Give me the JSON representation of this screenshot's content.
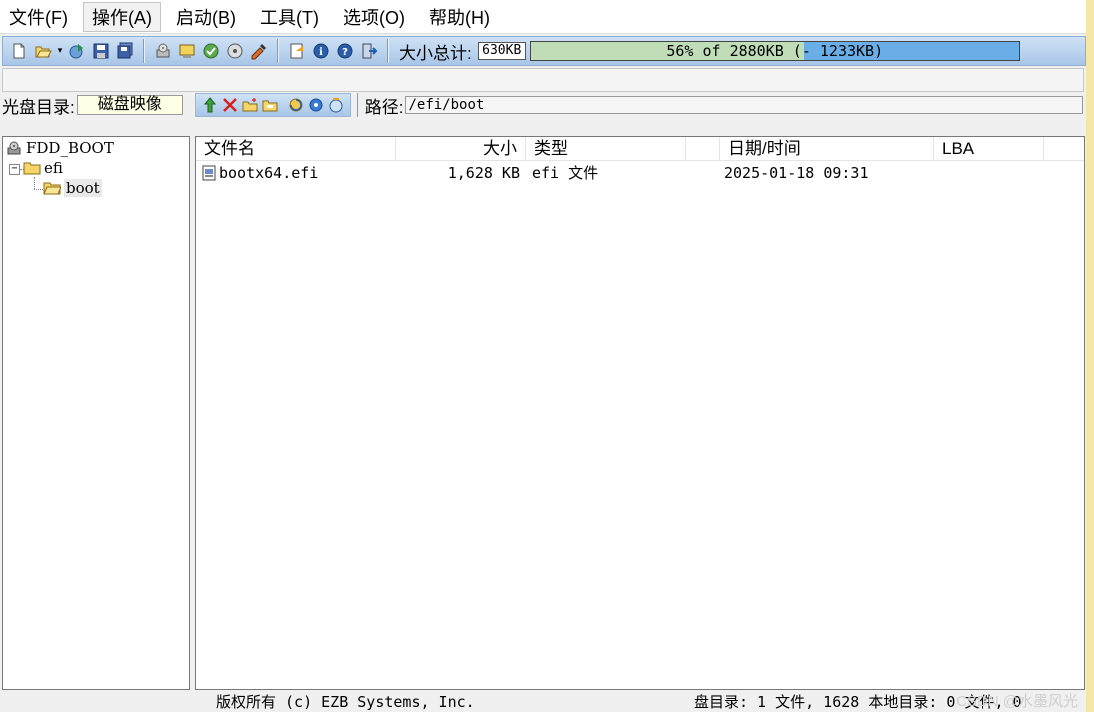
{
  "menu": {
    "items": [
      {
        "label": "文件(F)"
      },
      {
        "label": "操作(A)"
      },
      {
        "label": "启动(B)"
      },
      {
        "label": "工具(T)"
      },
      {
        "label": "选项(O)"
      },
      {
        "label": "帮助(H)"
      }
    ],
    "active_index": 1
  },
  "toolbar": {
    "buttons": [
      "new-icon",
      "open-icon",
      "extract-icon",
      "save-icon",
      "save-as-icon",
      "burn-icon",
      "mount-icon",
      "check-icon",
      "print-icon",
      "properties-icon",
      "register-icon",
      "info-icon",
      "help-icon",
      "exit-icon"
    ],
    "size_total_label": "大小总计:",
    "size_current": "630KB",
    "progress_text": "56% of 2880KB (- 1233KB)",
    "progress_fraction": 0.56
  },
  "pathbar": {
    "disc_dir_label": "光盘目录:",
    "disc_dir_value": "磁盘映像",
    "mini_buttons": [
      "up-icon",
      "delete-icon",
      "new-folder-icon",
      "rename-icon",
      "refresh-icon",
      "settings-icon",
      "add-icon"
    ],
    "path_label": "路径:",
    "path_value": "/efi/boot"
  },
  "tree": {
    "root": "FDD_BOOT",
    "efi": "efi",
    "boot": "boot"
  },
  "list": {
    "headers": {
      "name": "文件名",
      "size": "大小",
      "type": "类型",
      "date": "日期/时间",
      "lba": "LBA"
    },
    "rows": [
      {
        "name": "bootx64.efi",
        "size": "1,628 KB",
        "type": "efi 文件",
        "date": "2025-01-18 09:31",
        "lba": ""
      }
    ]
  },
  "status": {
    "copyright": "版权所有 (c) EZB Systems, Inc.",
    "summary": "盘目录: 1 文件, 1628 本地目录: 0 文件, 0",
    "watermark": "CSDN @水墨风光"
  },
  "colors": {
    "toolbar_bg": "#a8c6e8",
    "progress_bg": "#6aaee8",
    "progress_fill": "#c0ddb8",
    "disc_value_bg": "#ffffe6"
  }
}
